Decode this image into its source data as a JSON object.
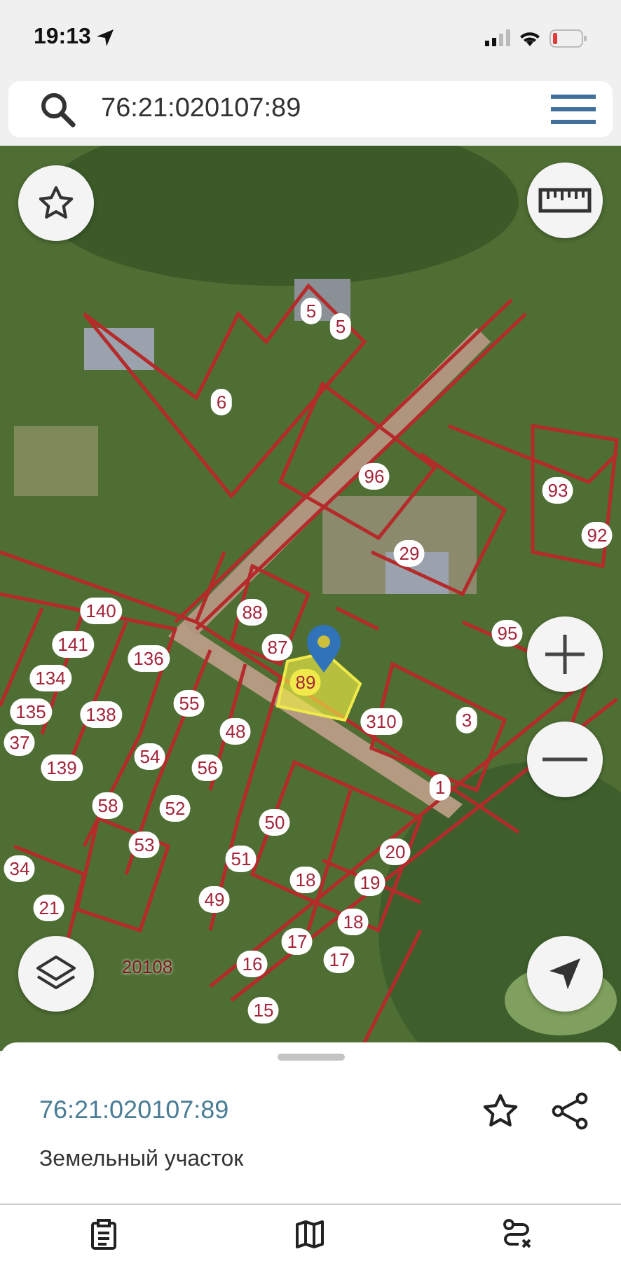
{
  "status_bar": {
    "time": "19:13"
  },
  "search": {
    "value": "76:21:020107:89"
  },
  "map": {
    "labels": [
      {
        "text": "5",
        "kind": "parcel",
        "selected": false
      },
      {
        "text": "5",
        "kind": "parcel",
        "selected": false
      },
      {
        "text": "6",
        "kind": "parcel",
        "selected": false
      },
      {
        "text": "96",
        "kind": "parcel",
        "selected": false
      },
      {
        "text": "93",
        "kind": "parcel",
        "selected": false
      },
      {
        "text": "29",
        "kind": "parcel",
        "selected": false
      },
      {
        "text": "92",
        "kind": "parcel",
        "selected": false
      },
      {
        "text": "140",
        "kind": "parcel",
        "selected": false
      },
      {
        "text": "88",
        "kind": "parcel",
        "selected": false
      },
      {
        "text": "141",
        "kind": "parcel",
        "selected": false
      },
      {
        "text": "87",
        "kind": "parcel",
        "selected": false
      },
      {
        "text": "95",
        "kind": "parcel",
        "selected": false
      },
      {
        "text": "136",
        "kind": "parcel",
        "selected": false
      },
      {
        "text": "134",
        "kind": "parcel",
        "selected": false
      },
      {
        "text": "89",
        "kind": "parcel",
        "selected": true
      },
      {
        "text": "135",
        "kind": "parcel",
        "selected": false
      },
      {
        "text": "138",
        "kind": "parcel",
        "selected": false
      },
      {
        "text": "55",
        "kind": "parcel",
        "selected": false
      },
      {
        "text": "310",
        "kind": "parcel",
        "selected": false
      },
      {
        "text": "3",
        "kind": "parcel",
        "selected": false
      },
      {
        "text": "48",
        "kind": "parcel",
        "selected": false
      },
      {
        "text": "37",
        "kind": "parcel",
        "selected": false
      },
      {
        "text": "139",
        "kind": "parcel",
        "selected": false
      },
      {
        "text": "54",
        "kind": "parcel",
        "selected": false
      },
      {
        "text": "56",
        "kind": "parcel",
        "selected": false
      },
      {
        "text": "1",
        "kind": "parcel",
        "selected": false
      },
      {
        "text": "58",
        "kind": "parcel",
        "selected": false
      },
      {
        "text": "52",
        "kind": "parcel",
        "selected": false
      },
      {
        "text": "50",
        "kind": "parcel",
        "selected": false
      },
      {
        "text": "53",
        "kind": "parcel",
        "selected": false
      },
      {
        "text": "20",
        "kind": "parcel",
        "selected": false
      },
      {
        "text": "34",
        "kind": "parcel",
        "selected": false
      },
      {
        "text": "51",
        "kind": "parcel",
        "selected": false
      },
      {
        "text": "18",
        "kind": "parcel",
        "selected": false
      },
      {
        "text": "19",
        "kind": "parcel",
        "selected": false
      },
      {
        "text": "21",
        "kind": "parcel",
        "selected": false
      },
      {
        "text": "49",
        "kind": "parcel",
        "selected": false
      },
      {
        "text": "18",
        "kind": "parcel",
        "selected": false
      },
      {
        "text": "17",
        "kind": "parcel",
        "selected": false
      },
      {
        "text": "20108",
        "kind": "quarter",
        "selected": false
      },
      {
        "text": "16",
        "kind": "parcel",
        "selected": false
      },
      {
        "text": "17",
        "kind": "parcel",
        "selected": false
      },
      {
        "text": "15",
        "kind": "parcel",
        "selected": false
      }
    ]
  },
  "sheet": {
    "title": "76:21:020107:89",
    "subtitle": "Земельный участок"
  }
}
